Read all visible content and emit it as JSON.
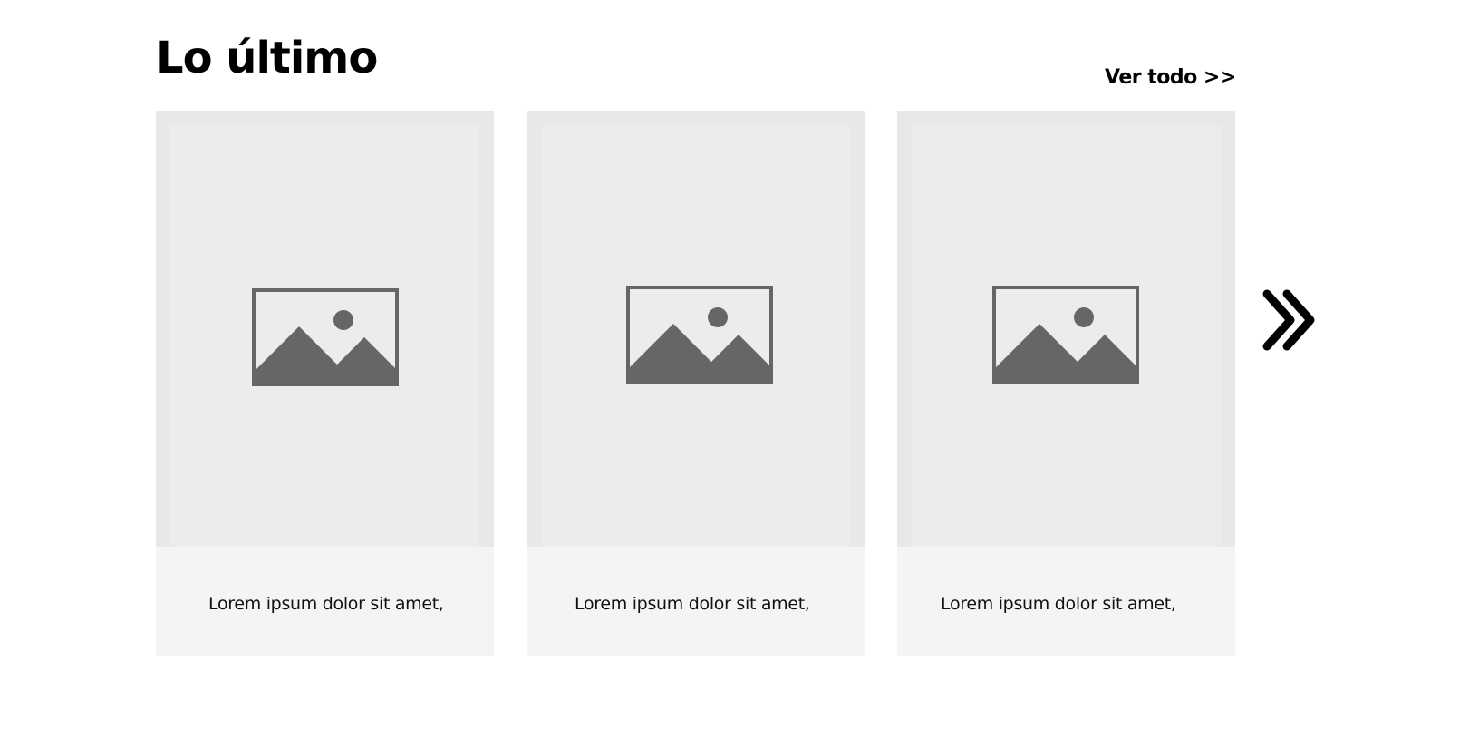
{
  "section": {
    "title": "Lo último",
    "view_all_label": "Ver todo >>"
  },
  "cards": [
    {
      "caption": "Lorem ipsum dolor sit amet,",
      "image_icon": "image-placeholder-icon"
    },
    {
      "caption": "Lorem ipsum dolor sit amet,",
      "image_icon": "image-placeholder-icon"
    },
    {
      "caption": "Lorem ipsum dolor sit amet,",
      "image_icon": "image-placeholder-icon"
    }
  ],
  "next_button": {
    "icon": "double-chevron-right-icon"
  },
  "colors": {
    "image_background": "#ececec",
    "caption_background": "#f4f4f4",
    "placeholder_icon": "#666666",
    "text": "#000000"
  }
}
